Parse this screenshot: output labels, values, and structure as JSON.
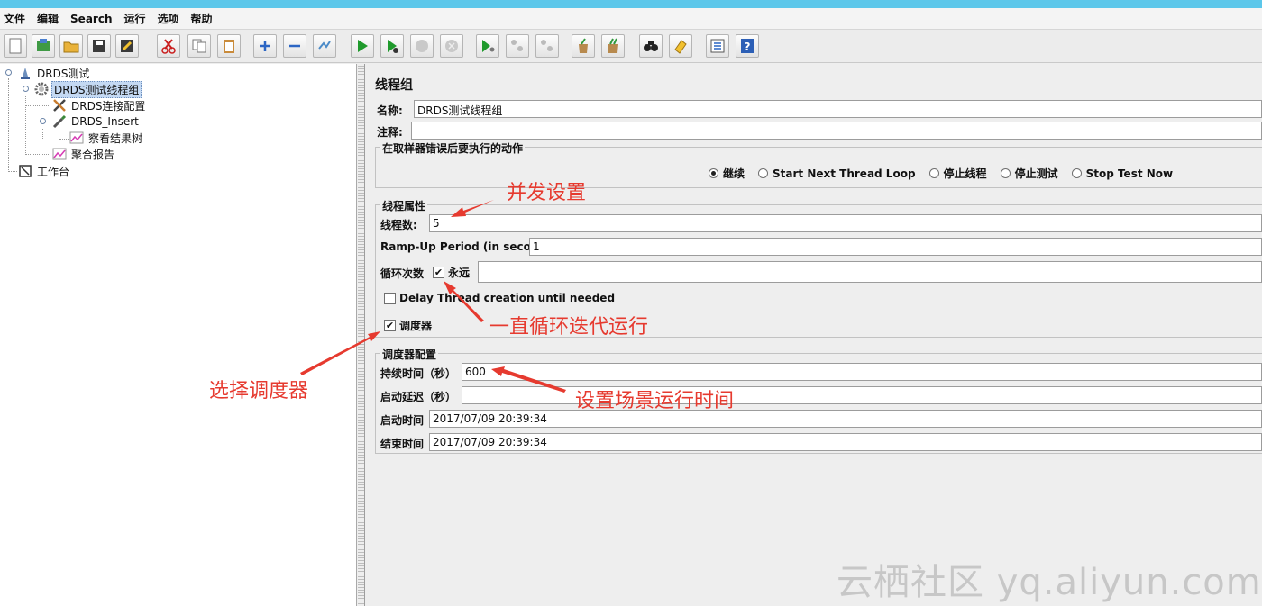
{
  "menu": [
    "文件",
    "编辑",
    "Search",
    "运行",
    "选项",
    "帮助"
  ],
  "toolbar_icons": [
    "new-icon",
    "templates-icon",
    "open-icon",
    "save-icon",
    "save-as-icon",
    "cut-icon",
    "copy-icon",
    "paste-icon",
    "expand-icon",
    "collapse-icon",
    "toggle-icon",
    "start-icon",
    "start-no-pause-icon",
    "stop-icon",
    "shutdown-icon",
    "remote-start-icon",
    "remote-stop-icon",
    "remote-shutdown-icon",
    "clear-icon",
    "clear-all-icon",
    "search-icon",
    "reset-search-icon",
    "function-helper-icon",
    "help-icon"
  ],
  "tree": {
    "root": "DRDS测试",
    "thread_group": "DRDS测试线程组",
    "connection_config": "DRDS连接配置",
    "sampler": "DRDS_Insert",
    "result_tree": "察看结果树",
    "aggregate_report": "聚合报告",
    "workbench": "工作台"
  },
  "panel": {
    "title": "线程组",
    "name_label": "名称:",
    "name_value": "DRDS测试线程组",
    "comment_label": "注释:",
    "comment_value": "",
    "error_action": {
      "legend": "在取样器错误后要执行的动作",
      "options": [
        "继续",
        "Start Next Thread Loop",
        "停止线程",
        "停止测试",
        "Stop Test Now"
      ],
      "selected": "继续"
    },
    "thread_props": {
      "legend": "线程属性",
      "threads_label": "线程数:",
      "threads_value": "5",
      "rampup_label": "Ramp-Up Period (in seconds):",
      "rampup_value": "1",
      "loop_label": "循环次数",
      "forever_label": "永远",
      "forever_checked": true,
      "loop_value": "",
      "delay_label": "Delay Thread creation until needed",
      "delay_checked": false,
      "scheduler_label": "调度器",
      "scheduler_checked": true
    },
    "scheduler": {
      "legend": "调度器配置",
      "duration_label": "持续时间（秒）",
      "duration_value": "600",
      "delay_label": "启动延迟（秒）",
      "delay_value": "",
      "start_label": "启动时间",
      "start_value": "2017/07/09 20:39:34",
      "end_label": "结束时间",
      "end_value": "2017/07/09 20:39:34"
    }
  },
  "annotations": {
    "concurrency": "并发设置",
    "loop_forever": "一直循环迭代运行",
    "choose_scheduler": "选择调度器",
    "set_duration": "设置场景运行时间"
  },
  "annotation_color": "#e63a2f",
  "watermark": "云栖社区 yq.aliyun.com"
}
